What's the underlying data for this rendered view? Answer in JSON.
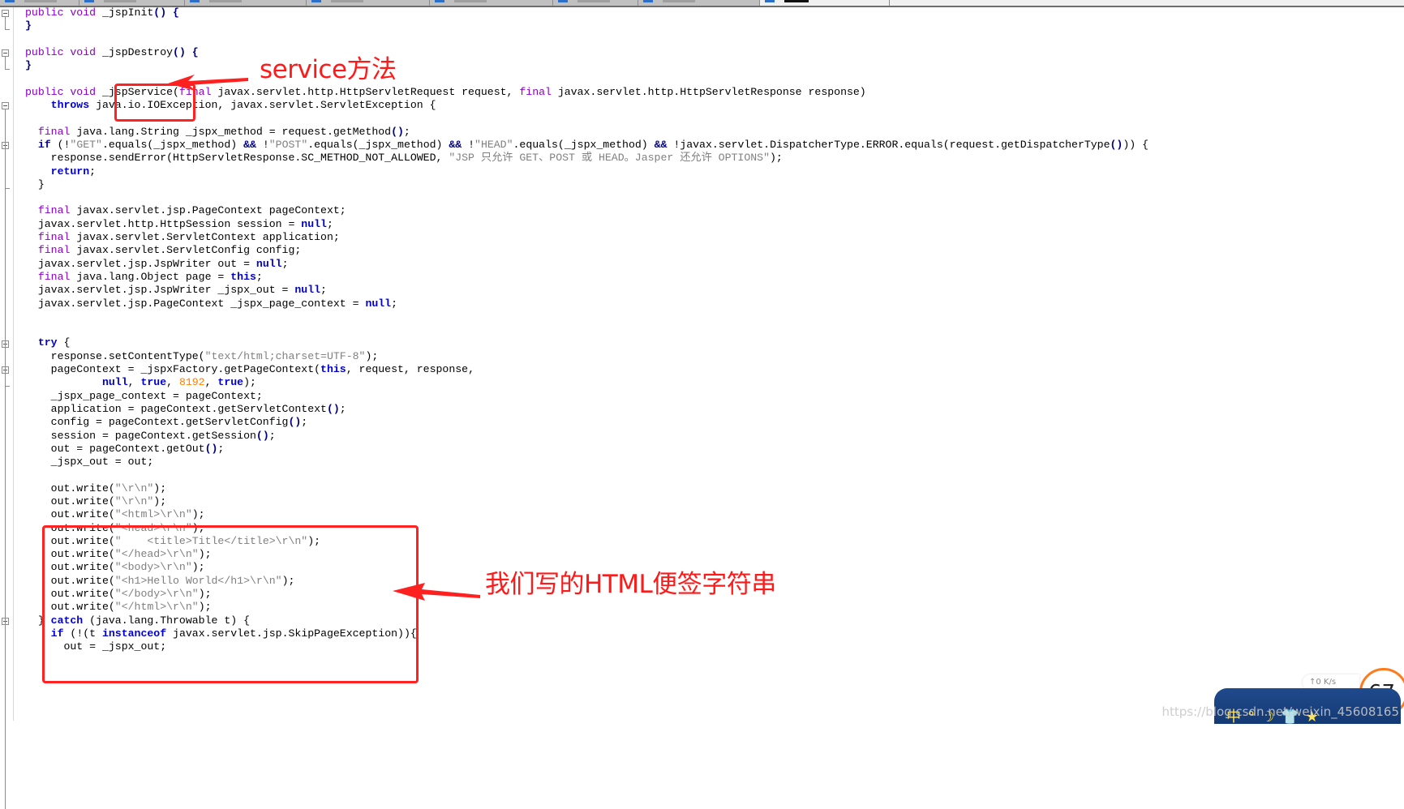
{
  "editor": {
    "tabs": [
      {
        "active": false
      },
      {
        "active": false
      },
      {
        "active": false
      },
      {
        "active": false
      },
      {
        "active": false
      },
      {
        "active": false
      },
      {
        "active": false
      },
      {
        "active": true
      }
    ],
    "code_lines": [
      [
        [
          "kw",
          "public void "
        ],
        [
          "",
          "_jspInit"
        ],
        [
          "op",
          "() {"
        ]
      ],
      [
        [
          "op",
          "}"
        ]
      ],
      [],
      [
        [
          "kw",
          "public void "
        ],
        [
          "",
          "_jspDestroy"
        ],
        [
          "op",
          "() {"
        ]
      ],
      [
        [
          "op",
          "}"
        ]
      ],
      [],
      [
        [
          "kw",
          "public void "
        ],
        [
          "",
          "_jspService("
        ],
        [
          "kw",
          "final "
        ],
        [
          "",
          "javax.servlet.http.HttpServletRequest request, "
        ],
        [
          "kw",
          "final "
        ],
        [
          "",
          "javax.servlet.http.HttpServletResponse response)"
        ]
      ],
      [
        [
          "",
          "    "
        ],
        [
          "kb",
          "throws "
        ],
        [
          "",
          "java.io.IOException, javax.servlet.ServletException {"
        ]
      ],
      [],
      [
        [
          "",
          "  "
        ],
        [
          "kw",
          "final "
        ],
        [
          "",
          "java.lang.String _jspx_method = request.getMethod"
        ],
        [
          "op",
          "()"
        ],
        [
          ";",
          " "
        ]
      ],
      [
        [
          "",
          "  "
        ],
        [
          "kb",
          "if "
        ],
        [
          "",
          "(!"
        ],
        [
          "str",
          "\"GET\""
        ],
        [
          "",
          ".equals(_jspx_method) "
        ],
        [
          "op",
          "&& "
        ],
        [
          "",
          "!"
        ],
        [
          "str",
          "\"POST\""
        ],
        [
          "",
          ".equals(_jspx_method) "
        ],
        [
          "op",
          "&& "
        ],
        [
          "",
          "!"
        ],
        [
          "str",
          "\"HEAD\""
        ],
        [
          "",
          ".equals(_jspx_method) "
        ],
        [
          "op",
          "&& "
        ],
        [
          "",
          "!javax.servlet.DispatcherType.ERROR.equals(request.getDispatcherType"
        ],
        [
          "op",
          "()"
        ],
        [
          "",
          ")) {"
        ]
      ],
      [
        [
          "",
          "    response.sendError(HttpServletResponse.SC_METHOD_NOT_ALLOWED, "
        ],
        [
          "str",
          "\"JSP 只允许 GET、POST 或 HEAD。Jasper 还允许 OPTIONS\""
        ],
        [
          "",
          ");"
        ]
      ],
      [
        [
          "",
          "    "
        ],
        [
          "kb",
          "return"
        ],
        [
          "",
          ";"
        ]
      ],
      [
        [
          "",
          "  }"
        ]
      ],
      [],
      [
        [
          "",
          "  "
        ],
        [
          "kw",
          "final "
        ],
        [
          "",
          "javax.servlet.jsp.PageContext pageContext;"
        ]
      ],
      [
        [
          "",
          "  javax.servlet.http.HttpSession session = "
        ],
        [
          "kb",
          "null"
        ],
        [
          "",
          ";"
        ]
      ],
      [
        [
          "",
          "  "
        ],
        [
          "kw",
          "final "
        ],
        [
          "",
          "javax.servlet.ServletContext application;"
        ]
      ],
      [
        [
          "",
          "  "
        ],
        [
          "kw",
          "final "
        ],
        [
          "",
          "javax.servlet.ServletConfig config;"
        ]
      ],
      [
        [
          "",
          "  javax.servlet.jsp.JspWriter out = "
        ],
        [
          "kb",
          "null"
        ],
        [
          "",
          ";"
        ]
      ],
      [
        [
          "",
          "  "
        ],
        [
          "kw",
          "final "
        ],
        [
          "",
          "java.lang.Object page = "
        ],
        [
          "kb",
          "this"
        ],
        [
          "",
          ";"
        ]
      ],
      [
        [
          "",
          "  javax.servlet.jsp.JspWriter _jspx_out = "
        ],
        [
          "kb",
          "null"
        ],
        [
          "",
          ";"
        ]
      ],
      [
        [
          "",
          "  javax.servlet.jsp.PageContext _jspx_page_context = "
        ],
        [
          "kb",
          "null"
        ],
        [
          "",
          ";"
        ]
      ],
      [],
      [],
      [
        [
          "",
          "  "
        ],
        [
          "kb",
          "try "
        ],
        [
          "",
          "{"
        ]
      ],
      [
        [
          "",
          "    response.setContentType("
        ],
        [
          "str",
          "\"text/html;charset=UTF-8\""
        ],
        [
          "",
          ");"
        ]
      ],
      [
        [
          "",
          "    pageContext = _jspxFactory.getPageContext("
        ],
        [
          "kb",
          "this"
        ],
        [
          "",
          ", request, response,"
        ]
      ],
      [
        [
          "",
          "            "
        ],
        [
          "kb",
          "null"
        ],
        [
          "",
          ", "
        ],
        [
          "kb",
          "true"
        ],
        [
          "",
          ", "
        ],
        [
          "num",
          "8192"
        ],
        [
          "",
          ", "
        ],
        [
          "kb",
          "true"
        ],
        [
          "",
          ");"
        ]
      ],
      [
        [
          "",
          "    _jspx_page_context = pageContext;"
        ]
      ],
      [
        [
          "",
          "    application = pageContext.getServletContext"
        ],
        [
          "op",
          "()"
        ],
        [
          "",
          ";"
        ]
      ],
      [
        [
          "",
          "    config = pageContext.getServletConfig"
        ],
        [
          "op",
          "()"
        ],
        [
          "",
          ";"
        ]
      ],
      [
        [
          "",
          "    session = pageContext.getSession"
        ],
        [
          "op",
          "()"
        ],
        [
          "",
          ";"
        ]
      ],
      [
        [
          "",
          "    out = pageContext.getOut"
        ],
        [
          "op",
          "()"
        ],
        [
          "",
          ";"
        ]
      ],
      [
        [
          "",
          "    _jspx_out = out;"
        ]
      ],
      [],
      [
        [
          "",
          "    out.write("
        ],
        [
          "str",
          "\"\\r\\n\""
        ],
        [
          "",
          ");"
        ]
      ],
      [
        [
          "",
          "    out.write("
        ],
        [
          "str",
          "\"\\r\\n\""
        ],
        [
          "",
          ");"
        ]
      ],
      [
        [
          "",
          "    out.write("
        ],
        [
          "str",
          "\"<html>\\r\\n\""
        ],
        [
          "",
          ");"
        ]
      ],
      [
        [
          "",
          "    out.write("
        ],
        [
          "str",
          "\"<head>\\r\\n\""
        ],
        [
          "",
          ");"
        ]
      ],
      [
        [
          "",
          "    out.write("
        ],
        [
          "str",
          "\"    <title>Title</title>\\r\\n\""
        ],
        [
          "",
          ");"
        ]
      ],
      [
        [
          "",
          "    out.write("
        ],
        [
          "str",
          "\"</head>\\r\\n\""
        ],
        [
          "",
          ");"
        ]
      ],
      [
        [
          "",
          "    out.write("
        ],
        [
          "str",
          "\"<body>\\r\\n\""
        ],
        [
          "",
          ");"
        ]
      ],
      [
        [
          "",
          "    out.write("
        ],
        [
          "str",
          "\"<h1>Hello World</h1>\\r\\n\""
        ],
        [
          "",
          ");"
        ]
      ],
      [
        [
          "",
          "    out.write("
        ],
        [
          "str",
          "\"</body>\\r\\n\""
        ],
        [
          "",
          ");"
        ]
      ],
      [
        [
          "",
          "    out.write("
        ],
        [
          "str",
          "\"</html>\\r\\n\""
        ],
        [
          "",
          ");"
        ]
      ],
      [
        [
          "",
          "  } "
        ],
        [
          "kb",
          "catch "
        ],
        [
          "",
          "(java.lang.Throwable t) {"
        ]
      ],
      [
        [
          "",
          "    "
        ],
        [
          "kb",
          "if "
        ],
        [
          "",
          "(!(t "
        ],
        [
          "kb",
          "instanceof "
        ],
        [
          "",
          "javax.servlet.jsp.SkipPageException)){"
        ]
      ],
      [
        [
          "",
          "      out = _jspx_out;"
        ]
      ]
    ]
  },
  "annotations": {
    "service_label": "service方法",
    "html_strings_label": "我们写的HTML便签字符串"
  },
  "overlay": {
    "watermark": "https://blog.csdn.net/weixin_45608165",
    "net_speed": "↑0  K/s",
    "ring_value": "67",
    "tray_icons": "中°☽👕★"
  }
}
